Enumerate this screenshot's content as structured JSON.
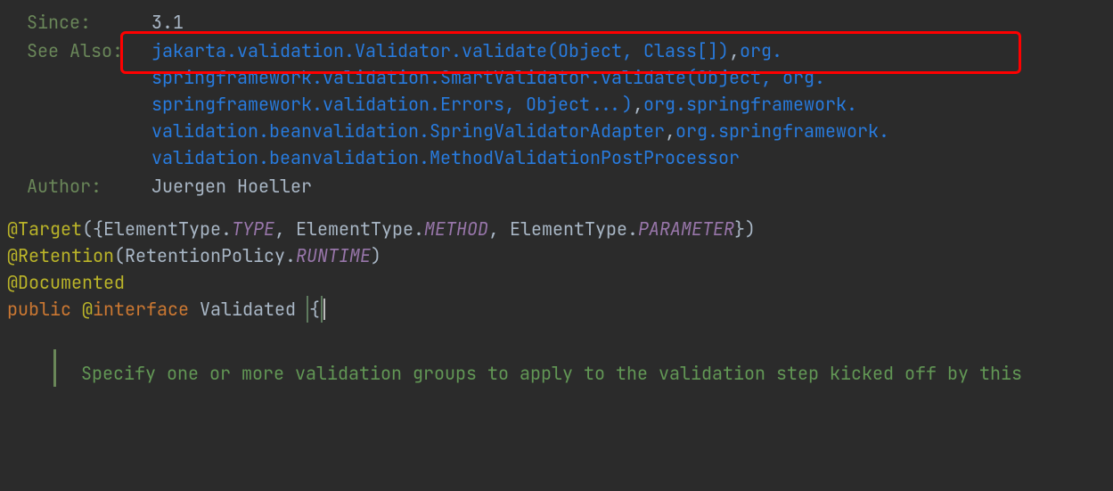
{
  "doc": {
    "since_label": "Since:",
    "since_value": "3.1",
    "seealso_label": "See Also:",
    "seealso_links": {
      "l1a": "jakarta.validation.Validator.validate(Object, Class[])",
      "l1b": "org.",
      "l2": "springframework.validation.SmartValidator.validate(Object, org.",
      "l3a": "springframework.validation.Errors, Object...)",
      "l3b": "org.springframework.",
      "l4a": "validation.beanvalidation.SpringValidatorAdapter",
      "l4b": "org.springframework.",
      "l5": "validation.beanvalidation.MethodValidationPostProcessor"
    },
    "author_label": "Author:",
    "author_value": "Juergen Hoeller"
  },
  "code": {
    "target_ann": "@Target",
    "target_open": "({",
    "et": "ElementType",
    "dot": ".",
    "type_const": "TYPE",
    "comma_sp": ", ",
    "method_const": "METHOD",
    "param_const": "PARAMETER",
    "target_close": "})",
    "retention_ann": "@Retention",
    "retention_open": "(",
    "rp": "RetentionPolicy",
    "runtime_const": "RUNTIME",
    "retention_close": ")",
    "documented": "@Documented",
    "public_kw": "public ",
    "at": "@",
    "interface_kw": "interface",
    "space": " ",
    "class_name": "Validated",
    "brace_open": "{"
  },
  "comment": {
    "text": "Specify one or more validation groups to apply to the validation step kicked off by this"
  }
}
